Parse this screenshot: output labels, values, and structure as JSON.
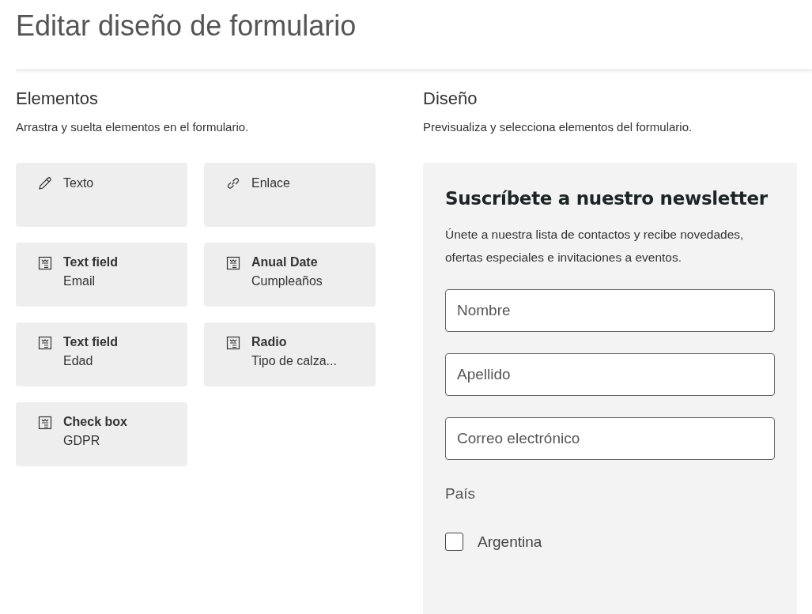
{
  "page_title": "Editar diseño de formulario",
  "elements": {
    "heading": "Elementos",
    "description": "Arrastra y suelta elementos en el formulario.",
    "items": [
      {
        "kind": "text",
        "label": "Texto"
      },
      {
        "kind": "link",
        "label": "Enlace"
      },
      {
        "kind": "field",
        "label": "Text field",
        "sublabel": "Email"
      },
      {
        "kind": "field",
        "label": "Anual Date",
        "sublabel": "Cumpleaños"
      },
      {
        "kind": "field",
        "label": "Text field",
        "sublabel": "Edad"
      },
      {
        "kind": "field",
        "label": "Radio",
        "sublabel": "Tipo de calza..."
      },
      {
        "kind": "field",
        "label": "Check box",
        "sublabel": "GDPR"
      }
    ]
  },
  "design": {
    "heading": "Diseño",
    "description": "Previsualiza y selecciona elementos del formulario.",
    "form": {
      "title": "Suscríbete a nuestro newsletter",
      "intro": "Únete a nuestra lista de contactos y recibe novedades, ofertas especiales e invitaciones a eventos.",
      "fields": [
        {
          "placeholder": "Nombre"
        },
        {
          "placeholder": "Apellido"
        },
        {
          "placeholder": "Correo electrónico"
        }
      ],
      "group_label": "País",
      "options": [
        {
          "label": "Argentina",
          "checked": false
        }
      ]
    }
  }
}
